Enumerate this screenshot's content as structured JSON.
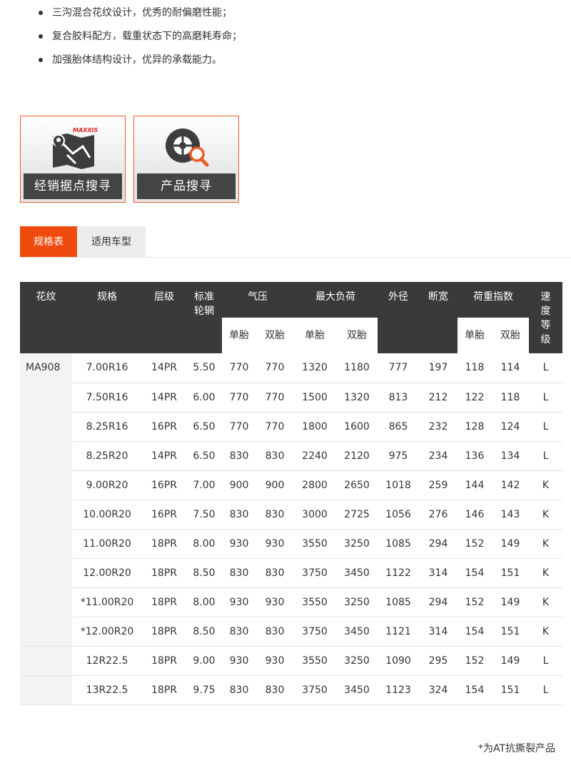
{
  "features": [
    "三沟混合花纹设计，优秀的耐偏磨性能；",
    "复合胶料配方，载重状态下的高磨耗寿命；",
    "加强胎体结构设计，优异的承载能力。"
  ],
  "buttons": {
    "dealer": {
      "label": "经销据点搜寻",
      "logo_text": "MAXXIS",
      "icon": "map-pin-icon"
    },
    "product": {
      "label": "产品搜寻",
      "icon": "tire-search-icon"
    }
  },
  "colors": {
    "accent": "#f15a22",
    "header_bg": "#3a3a3a"
  },
  "tabs": [
    {
      "label": "规格表",
      "active": true
    },
    {
      "label": "适用车型",
      "active": false
    }
  ],
  "table": {
    "headers": {
      "pattern": "花纹",
      "size": "规格",
      "ply": "层级",
      "rim": "标准轮辋",
      "pressure": "气压",
      "max_load": "最大负荷",
      "diameter": "外径",
      "width": "断宽",
      "load_index": "荷重指数",
      "speed": "速度等级",
      "single": "单胎",
      "dual": "双胎"
    },
    "pattern_name": "MA908",
    "rows": [
      [
        "7.00R16",
        "14PR",
        "5.50",
        "770",
        "770",
        "1320",
        "1180",
        "777",
        "197",
        "118",
        "114",
        "L"
      ],
      [
        "7.50R16",
        "14PR",
        "6.00",
        "770",
        "770",
        "1500",
        "1320",
        "813",
        "212",
        "122",
        "118",
        "L"
      ],
      [
        "8.25R16",
        "16PR",
        "6.50",
        "770",
        "770",
        "1800",
        "1600",
        "865",
        "232",
        "128",
        "124",
        "L"
      ],
      [
        "8.25R20",
        "14PR",
        "6.50",
        "830",
        "830",
        "2240",
        "2120",
        "975",
        "234",
        "136",
        "134",
        "L"
      ],
      [
        "9.00R20",
        "16PR",
        "7.00",
        "900",
        "900",
        "2800",
        "2650",
        "1018",
        "259",
        "144",
        "142",
        "K"
      ],
      [
        "10.00R20",
        "16PR",
        "7.50",
        "830",
        "830",
        "3000",
        "2725",
        "1056",
        "276",
        "146",
        "143",
        "K"
      ],
      [
        "11.00R20",
        "18PR",
        "8.00",
        "930",
        "930",
        "3550",
        "3250",
        "1085",
        "294",
        "152",
        "149",
        "K"
      ],
      [
        "12.00R20",
        "18PR",
        "8.50",
        "830",
        "830",
        "3750",
        "3450",
        "1122",
        "314",
        "154",
        "151",
        "K"
      ],
      [
        "*11.00R20",
        "18PR",
        "8.00",
        "930",
        "930",
        "3550",
        "3250",
        "1085",
        "294",
        "152",
        "149",
        "K"
      ],
      [
        "*12.00R20",
        "18PR",
        "8.50",
        "830",
        "830",
        "3750",
        "3450",
        "1121",
        "314",
        "154",
        "151",
        "K"
      ],
      [
        "12R22.5",
        "18PR",
        "9.00",
        "930",
        "930",
        "3550",
        "3250",
        "1090",
        "295",
        "152",
        "149",
        "L"
      ],
      [
        "13R22.5",
        "18PR",
        "9.75",
        "830",
        "830",
        "3750",
        "3450",
        "1123",
        "324",
        "154",
        "151",
        "L"
      ]
    ]
  },
  "footnote": "*为AT抗撕裂产品"
}
